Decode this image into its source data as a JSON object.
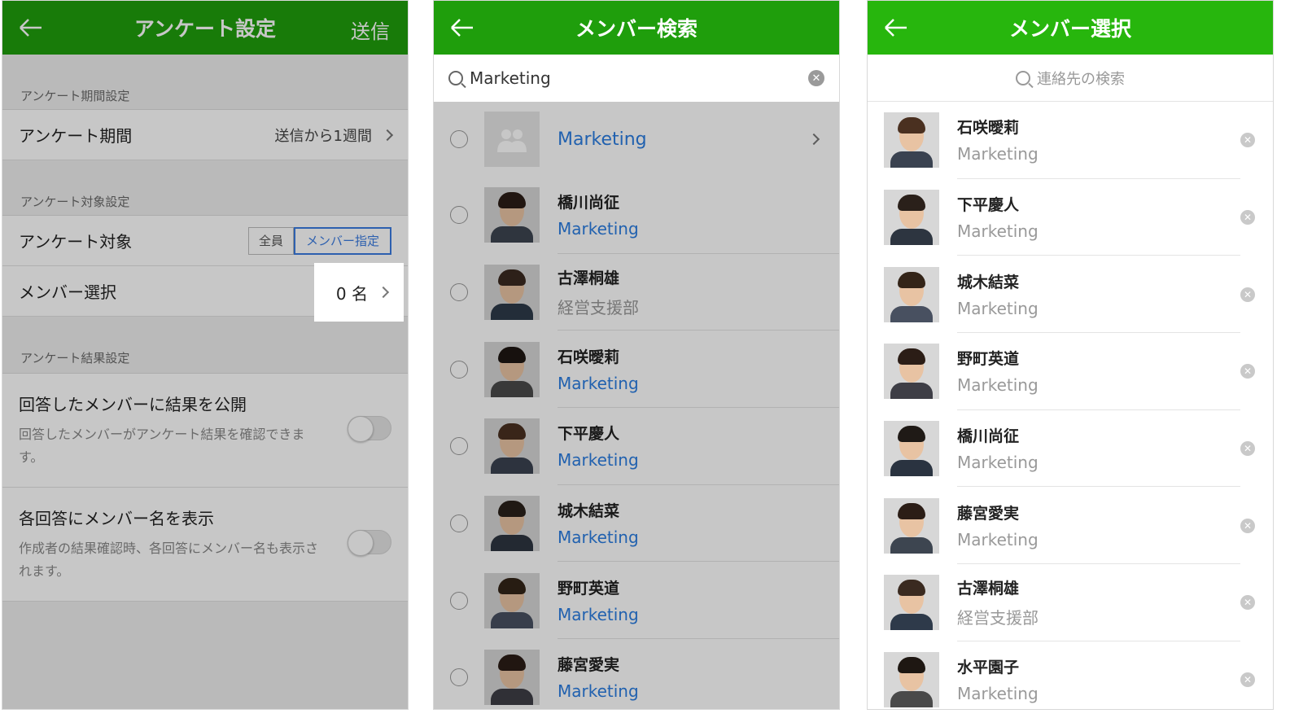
{
  "colors": {
    "accent_green": "#1f9e0c",
    "accent_green_bright": "#27b60d",
    "link_blue": "#2b7de0"
  },
  "s1": {
    "title": "アンケート設定",
    "send": "送信",
    "period_section": "アンケート期間設定",
    "period_label": "アンケート期間",
    "period_value": "送信から1週間",
    "target_section": "アンケート対象設定",
    "target_label": "アンケート対象",
    "target_all": "全員",
    "target_members": "メンバー指定",
    "member_select_label": "メンバー選択",
    "member_count": "0 名",
    "result_section": "アンケート結果設定",
    "toggle1_title": "回答したメンバーに結果を公開",
    "toggle1_desc": "回答したメンバーがアンケート結果を確認できます。",
    "toggle2_title": "各回答にメンバー名を表示",
    "toggle2_desc": "作成者の結果確認時、各回答にメンバー名も表示されます。"
  },
  "s2": {
    "title": "メンバー検索",
    "search_value": "Marketing",
    "group_name": "Marketing",
    "members": [
      {
        "name": "橋川尚征",
        "dept": "Marketing",
        "blue": true
      },
      {
        "name": "古澤桐雄",
        "dept": "経営支援部",
        "blue": false
      },
      {
        "name": "石咲曖莉",
        "dept": "Marketing",
        "blue": true
      },
      {
        "name": "下平慶人",
        "dept": "Marketing",
        "blue": true
      },
      {
        "name": "城木結菜",
        "dept": "Marketing",
        "blue": true
      },
      {
        "name": "野町英道",
        "dept": "Marketing",
        "blue": true
      },
      {
        "name": "藤宮愛実",
        "dept": "Marketing",
        "blue": true
      }
    ]
  },
  "s3": {
    "title": "メンバー選択",
    "search_placeholder": "連絡先の検索",
    "members": [
      {
        "name": "石咲曖莉",
        "dept": "Marketing"
      },
      {
        "name": "下平慶人",
        "dept": "Marketing"
      },
      {
        "name": "城木結菜",
        "dept": "Marketing"
      },
      {
        "name": "野町英道",
        "dept": "Marketing"
      },
      {
        "name": "橋川尚征",
        "dept": "Marketing"
      },
      {
        "name": "藤宮愛実",
        "dept": "Marketing"
      },
      {
        "name": "古澤桐雄",
        "dept": "経営支援部"
      },
      {
        "name": "水平園子",
        "dept": "Marketing"
      }
    ]
  }
}
